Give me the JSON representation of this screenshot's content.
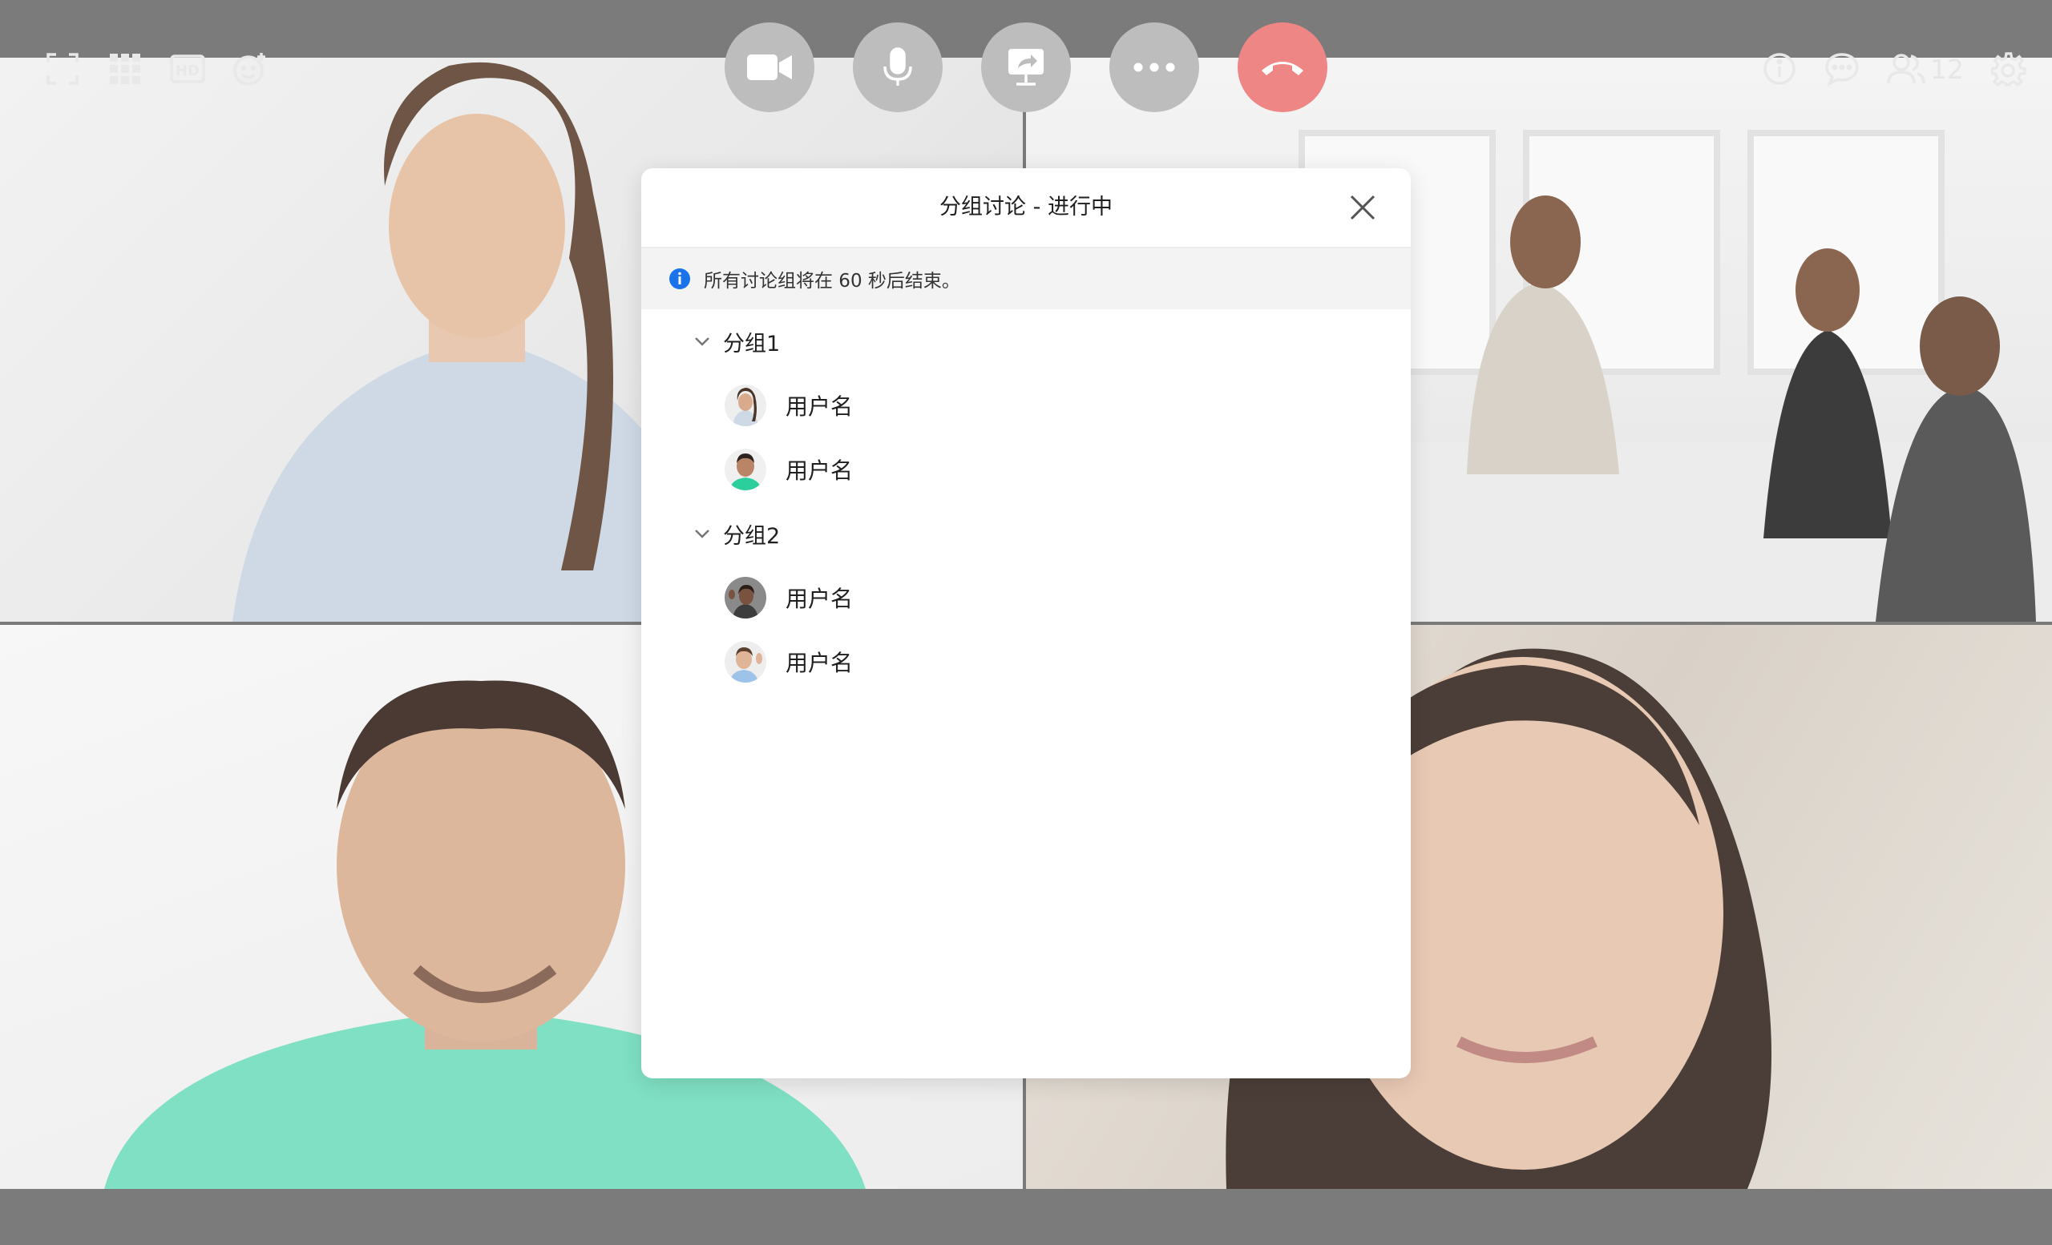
{
  "top_controls": {
    "left_tools": [
      {
        "icon": "fullscreen-icon"
      },
      {
        "icon": "grid-view-icon"
      },
      {
        "icon": "hd-icon",
        "label": "HD"
      },
      {
        "icon": "emoji-add-icon"
      }
    ],
    "center_controls": [
      {
        "icon": "camera-icon"
      },
      {
        "icon": "microphone-icon"
      },
      {
        "icon": "share-screen-icon"
      },
      {
        "icon": "more-icon"
      },
      {
        "icon": "hang-up-icon",
        "color": "#ef8686"
      }
    ],
    "right_tools": [
      {
        "icon": "info-icon"
      },
      {
        "icon": "chat-icon"
      },
      {
        "icon": "participants-icon",
        "count": "12"
      },
      {
        "icon": "settings-icon"
      }
    ]
  },
  "dialog": {
    "title": "分组讨论 - 进行中",
    "notice": "所有讨论组将在 60 秒后结束。",
    "notice_icon_color": "#1a73e8",
    "groups": [
      {
        "label": "分组1",
        "members": [
          {
            "name": "用户名",
            "avatar": "woman-avatar"
          },
          {
            "name": "用户名",
            "avatar": "man-green-shirt-avatar"
          }
        ]
      },
      {
        "label": "分组2",
        "members": [
          {
            "name": "用户名",
            "avatar": "woman-waving-avatar"
          },
          {
            "name": "用户名",
            "avatar": "man-waving-avatar"
          }
        ]
      }
    ]
  }
}
